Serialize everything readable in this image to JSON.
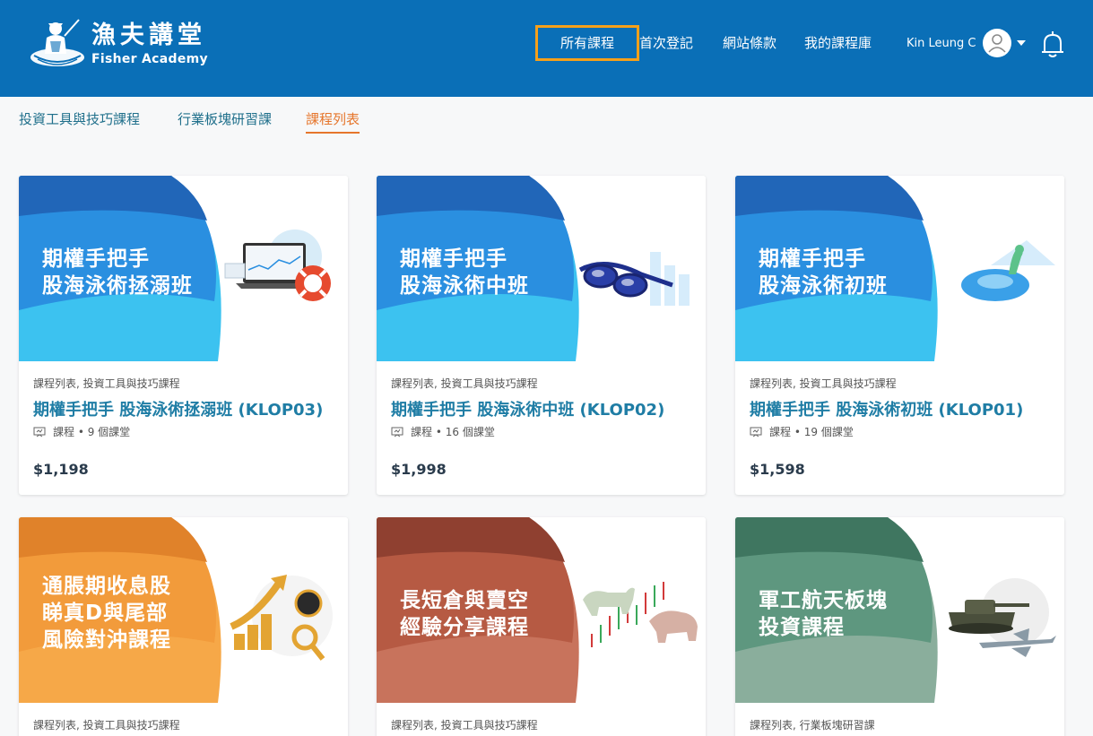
{
  "brand": {
    "name_cn": "漁夫講堂",
    "name_en": "Fisher Academy"
  },
  "nav": [
    {
      "label": "所有課程",
      "active": true
    },
    {
      "label": "首次登記",
      "active": false
    },
    {
      "label": "網站條款",
      "active": false
    },
    {
      "label": "我的課程庫",
      "active": false
    }
  ],
  "user": {
    "name": "Kin Leung C"
  },
  "subnav": [
    {
      "label": "投資工具與技巧課程",
      "active": false
    },
    {
      "label": "行業板塊研習課",
      "active": false
    },
    {
      "label": "課程列表",
      "active": true
    }
  ],
  "courses": [
    {
      "banner_lines": [
        "期權手把手",
        "股海泳術拯溺班"
      ],
      "categories": "課程列表, 投資工具與技巧課程",
      "title": "期權手把手 股海泳術拯溺班 (KLOP03)",
      "type": "課程",
      "lessons": "9 個課堂",
      "price": "$1,198",
      "theme": "#2a8fe0"
    },
    {
      "banner_lines": [
        "期權手把手",
        "股海泳術中班"
      ],
      "categories": "課程列表, 投資工具與技巧課程",
      "title": "期權手把手 股海泳術中班 (KLOP02)",
      "type": "課程",
      "lessons": "16 個課堂",
      "price": "$1,998",
      "theme": "#2a8fe0"
    },
    {
      "banner_lines": [
        "期權手把手",
        "股海泳術初班"
      ],
      "categories": "課程列表, 投資工具與技巧課程",
      "title": "期權手把手 股海泳術初班 (KLOP01)",
      "type": "課程",
      "lessons": "19 個課堂",
      "price": "$1,598",
      "theme": "#2a8fe0"
    },
    {
      "banner_lines": [
        "通脹期收息股",
        "睇真D與尾部",
        "風險對沖課程"
      ],
      "categories": "課程列表, 投資工具與技巧課程",
      "theme": "#f29b3b"
    },
    {
      "banner_lines": [
        "長短倉與賣空",
        "經驗分享課程"
      ],
      "categories": "課程列表, 投資工具與技巧課程",
      "theme": "#b65a43"
    },
    {
      "banner_lines": [
        "軍工航天板塊",
        "投資課程"
      ],
      "categories": "課程列表, 行業板塊研習課",
      "theme": "#4f8b72"
    }
  ],
  "colors": {
    "header": "#0a6fb7",
    "nav_highlight": "#f6a01a",
    "subnav_active": "#e6762c",
    "link": "#1f7da5"
  }
}
